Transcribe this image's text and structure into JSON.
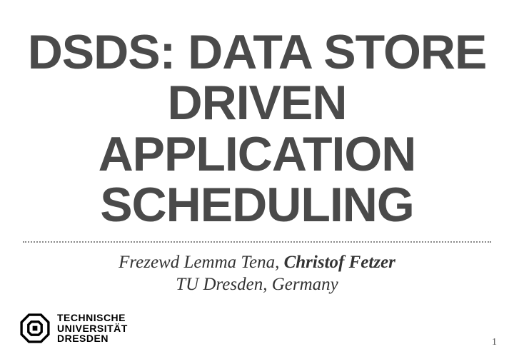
{
  "title": "DSDS: DATA STORE DRIVEN APPLICATION SCHEDULING",
  "authors": {
    "line1_pre": "Frezewd Lemma Tena, ",
    "presenter": "Christof Fetzer",
    "line2": "TU Dresden, Germany"
  },
  "logo": {
    "line1": "TECHNISCHE",
    "line2": "UNIVERSITÄT",
    "line3": "DRESDEN"
  },
  "page_number": "1"
}
